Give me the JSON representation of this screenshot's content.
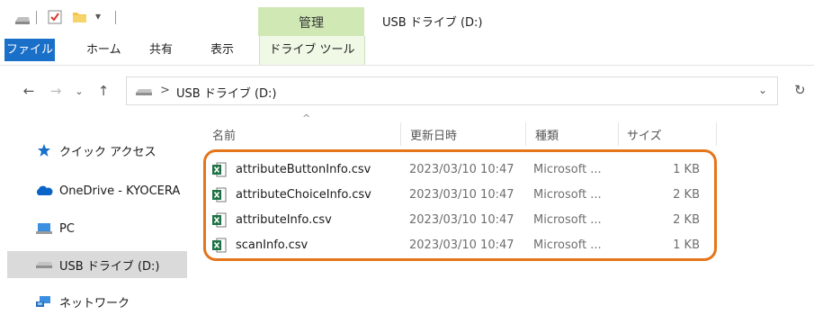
{
  "window": {
    "title": "USB ドライブ (D:)",
    "context_group": "管理"
  },
  "quick_access": {
    "icons": [
      "drive-icon",
      "properties-check-icon",
      "new-folder-icon",
      "customize-dropdown-icon"
    ]
  },
  "ribbon": {
    "tabs": [
      {
        "label": "ファイル",
        "active": true
      },
      {
        "label": "ホーム"
      },
      {
        "label": "共有"
      },
      {
        "label": "表示"
      },
      {
        "label": "ドライブ ツール"
      }
    ]
  },
  "address_bar": {
    "path_separator": ">",
    "path": "USB ドライブ (D:)",
    "dropdown_icon": "chevron-down-icon",
    "refresh_icon": "refresh-icon"
  },
  "navigation": {
    "items": [
      {
        "label": "クイック アクセス",
        "icon": "star-icon"
      },
      {
        "label": "OneDrive - KYOCERA",
        "icon": "cloud-icon"
      },
      {
        "label": "PC",
        "icon": "pc-icon"
      },
      {
        "label": "USB ドライブ (D:)",
        "icon": "usb-drive-icon",
        "selected": true
      },
      {
        "label": "ネットワーク",
        "icon": "network-icon"
      }
    ]
  },
  "file_list": {
    "columns": {
      "name": "名前",
      "date": "更新日時",
      "type": "種類",
      "size": "サイズ"
    },
    "sort_indicator": "^",
    "files": [
      {
        "name": "attributeButtonInfo.csv",
        "date": "2023/03/10 10:47",
        "type": "Microsoft ...",
        "size": "1 KB",
        "icon": "excel-csv-icon"
      },
      {
        "name": "attributeChoiceInfo.csv",
        "date": "2023/03/10 10:47",
        "type": "Microsoft ...",
        "size": "2 KB",
        "icon": "excel-csv-icon"
      },
      {
        "name": "attributeInfo.csv",
        "date": "2023/03/10 10:47",
        "type": "Microsoft ...",
        "size": "2 KB",
        "icon": "excel-csv-icon"
      },
      {
        "name": "scanInfo.csv",
        "date": "2023/03/10 10:47",
        "type": "Microsoft ...",
        "size": "1 KB",
        "icon": "excel-csv-icon"
      }
    ]
  },
  "colors": {
    "file_tab": "#1a6fc9",
    "context_tab": "#cfe8b4",
    "highlight_border": "#e4751b",
    "selected_nav": "#dadada",
    "excel_green": "#1d7144"
  }
}
